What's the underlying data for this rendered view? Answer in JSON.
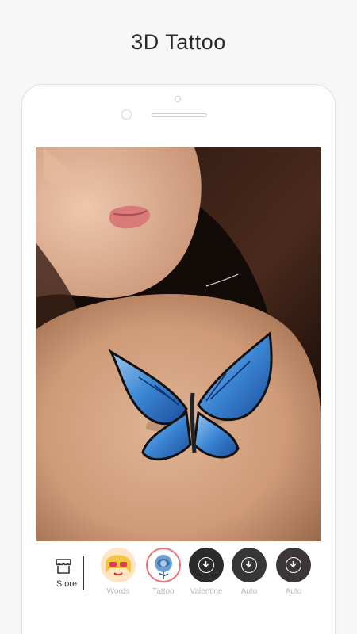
{
  "promo": {
    "title": "3D Tattoo"
  },
  "toolbar": {
    "store_label": "Store",
    "categories": [
      {
        "label": "Words",
        "icon": "sunglasses-girl-sticker",
        "selected": false
      },
      {
        "label": "Tattoo",
        "icon": "blue-rose-sticker",
        "selected": true
      },
      {
        "label": "Valentine",
        "icon": "download-icon",
        "selected": false
      },
      {
        "label": "Auto",
        "icon": "download-icon",
        "selected": false
      },
      {
        "label": "Auto",
        "icon": "download-icon",
        "selected": false
      }
    ]
  },
  "colors": {
    "selected_ring": "#f06f78",
    "label_gray": "#b9b9b9",
    "background": "#f7f7f7"
  }
}
